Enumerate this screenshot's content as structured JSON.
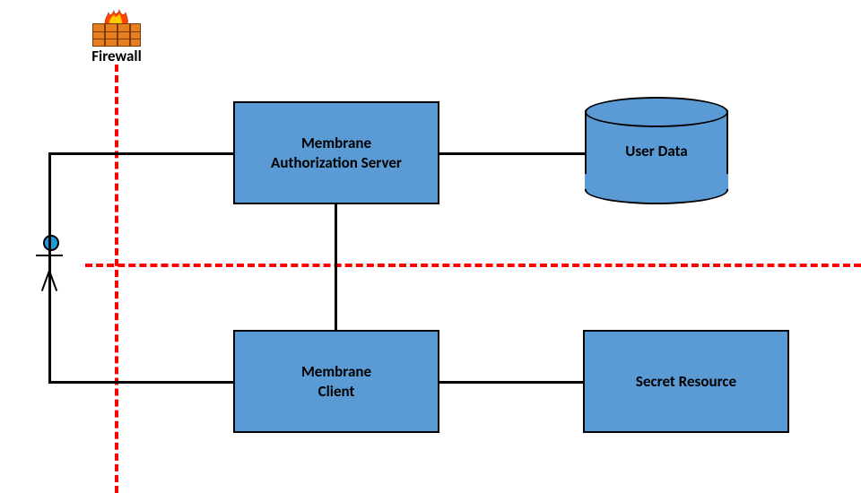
{
  "firewall": {
    "label": "Firewall"
  },
  "actor": {
    "label": ""
  },
  "nodes": {
    "authServer": {
      "label": "Membrane\nAuthorization Server"
    },
    "userData": {
      "label": "User Data"
    },
    "client": {
      "label": "Membrane\nClient"
    },
    "secretResource": {
      "label": "Secret Resource"
    }
  }
}
